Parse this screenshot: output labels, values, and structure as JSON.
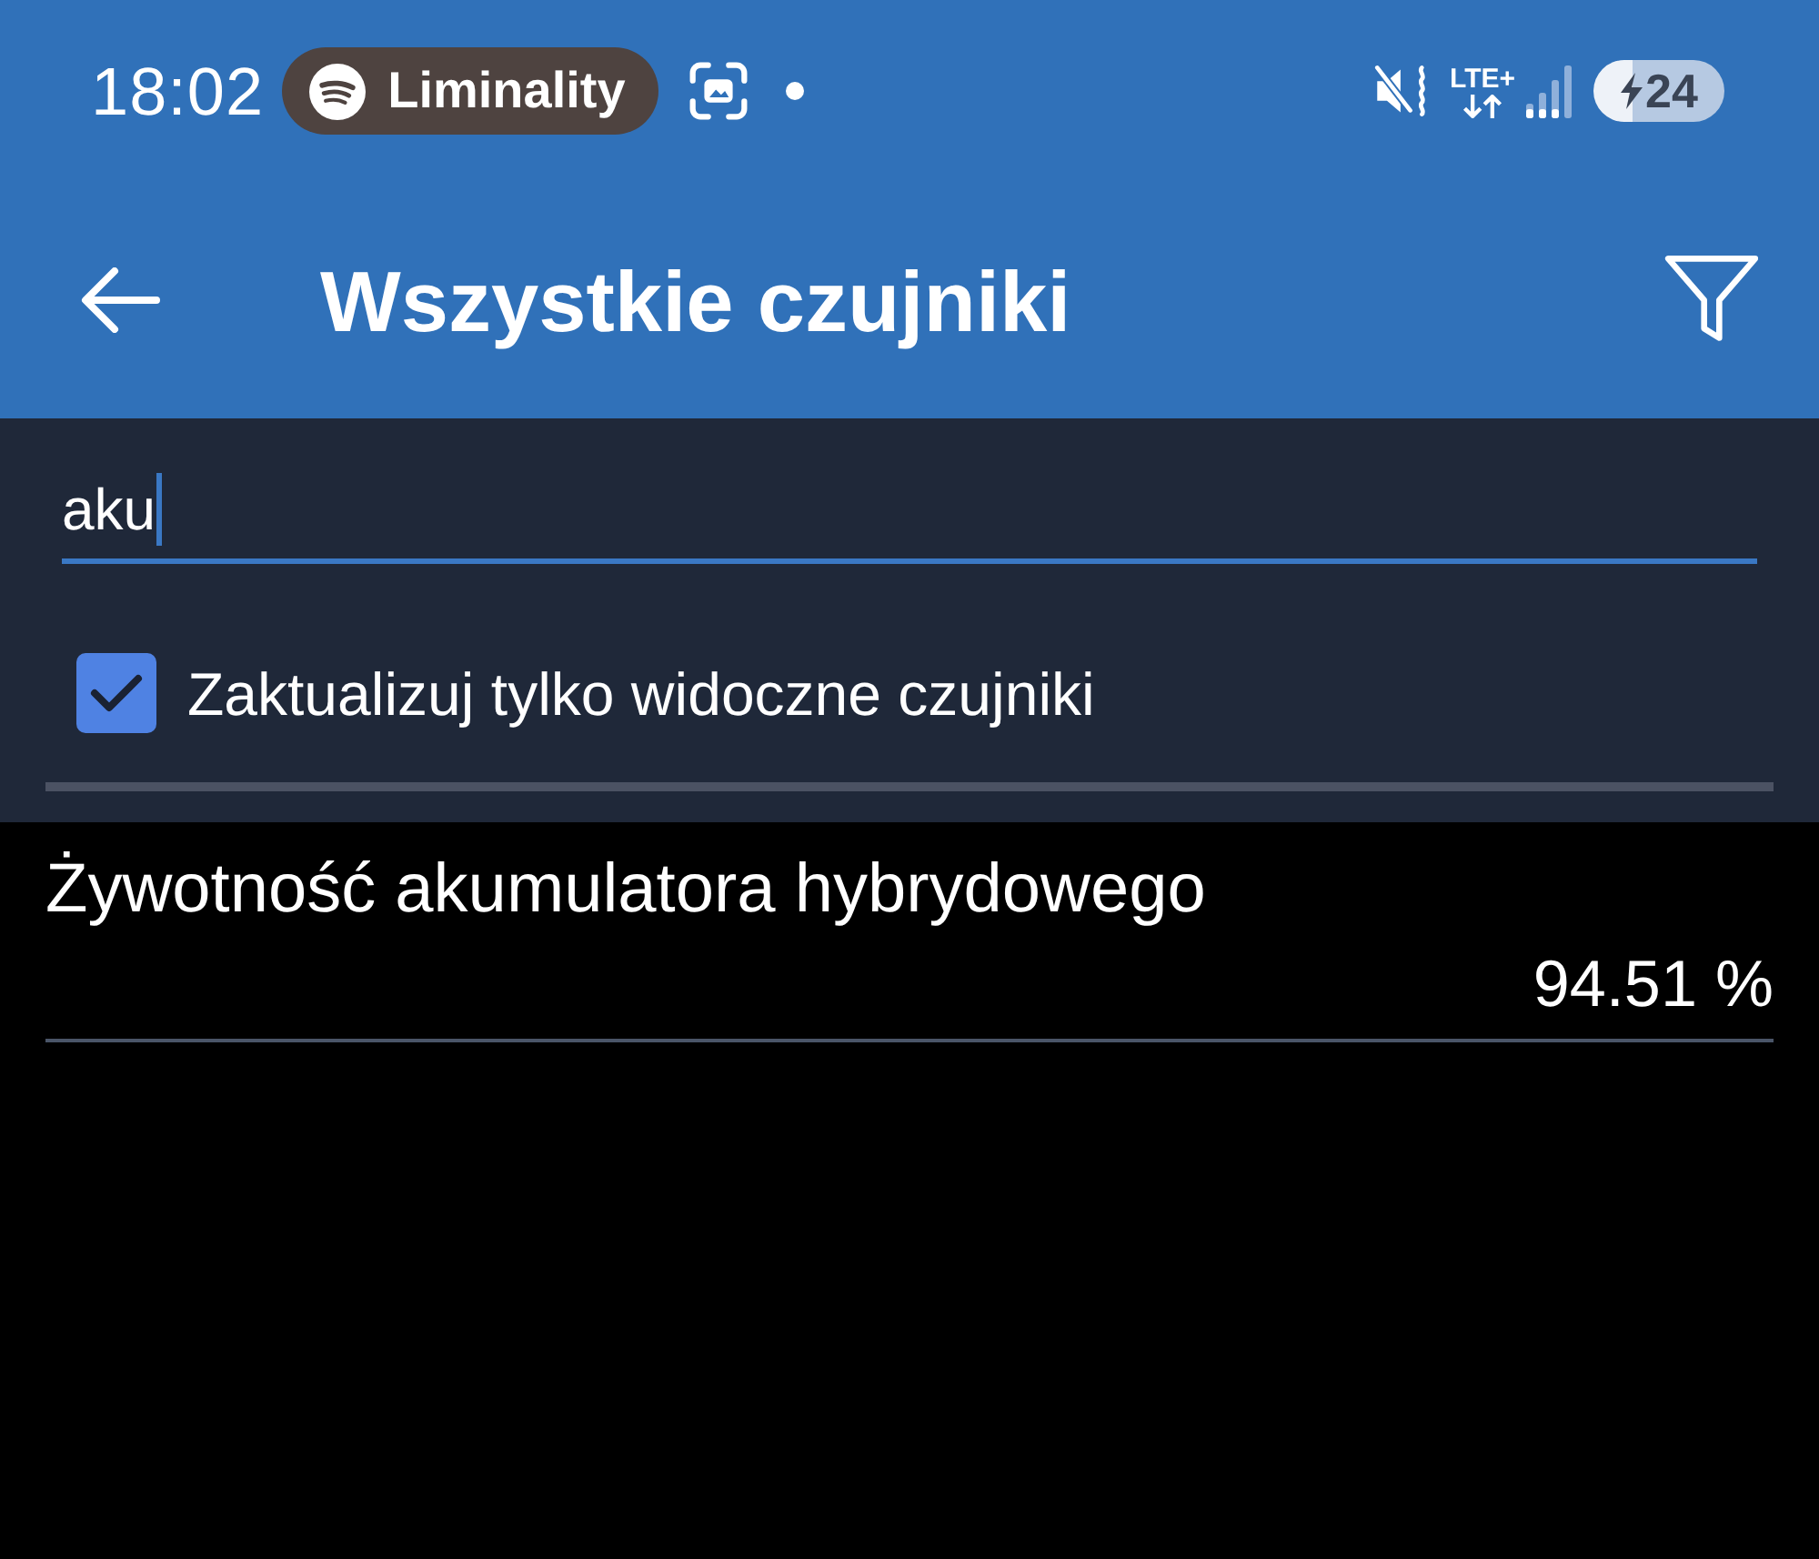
{
  "status_bar": {
    "time": "18:02",
    "media_chip": {
      "label": "Liminality"
    },
    "network": "LTE+",
    "battery": {
      "text": "24",
      "charging": true
    }
  },
  "app_bar": {
    "title": "Wszystkie czujniki"
  },
  "search": {
    "value": "aku"
  },
  "visible_only": {
    "label": "Zaktualizuj tylko widoczne czujniki",
    "checked": true
  },
  "sensors": [
    {
      "name": "Żywotność akumulatora hybrydowego",
      "value": "94.51 %"
    }
  ]
}
